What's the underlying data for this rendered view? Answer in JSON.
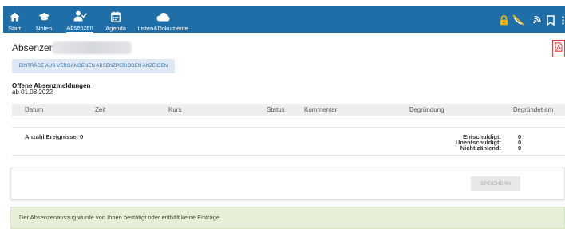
{
  "nav": {
    "items": [
      {
        "label": "Start",
        "icon": "home-icon"
      },
      {
        "label": "Noten",
        "icon": "graduation-cap-icon"
      },
      {
        "label": "Absenzen",
        "icon": "person-check-icon",
        "active": true
      },
      {
        "label": "Agenda",
        "icon": "calendar-icon"
      },
      {
        "label": "Listen&Dokumente",
        "icon": "cloud-icon"
      }
    ],
    "right_icons": [
      "lock-icon",
      "no-phone-icon",
      "nfc-icon",
      "bookmark-icon",
      "more-icon"
    ],
    "accent_lock": "#f5b400",
    "bar_color": "#1f6ea8"
  },
  "page": {
    "title": "Absenzen -",
    "history_button": "EINTRÄGE AUS VERGANGENEN ABSENZPERIODEN ANZEIGEN",
    "section_title": "Offene Absenzmeldungen",
    "section_subtitle": "ab 01.08.2022",
    "pdf_icon": "pdf-icon",
    "pdf_color": "#e13b3b"
  },
  "table": {
    "headers": [
      "Datum",
      "Zeit",
      "Kurs",
      "Status",
      "Kommentar",
      "Begründung",
      "Begründet am"
    ],
    "rows": [],
    "event_count": "Anzahl Ereignisse: 0",
    "stats": [
      {
        "label": "Entschuldigt:",
        "value": "0"
      },
      {
        "label": "Unentschuldigt:",
        "value": "0"
      },
      {
        "label": "Nicht zählend:",
        "value": "0"
      }
    ]
  },
  "save": {
    "label": "SPEICHERN"
  },
  "info": {
    "text": "Der Absenzenauszug wurde von Ihnen bestätigt oder enthält keine Einträge.",
    "bg": "#e6f0d8"
  }
}
